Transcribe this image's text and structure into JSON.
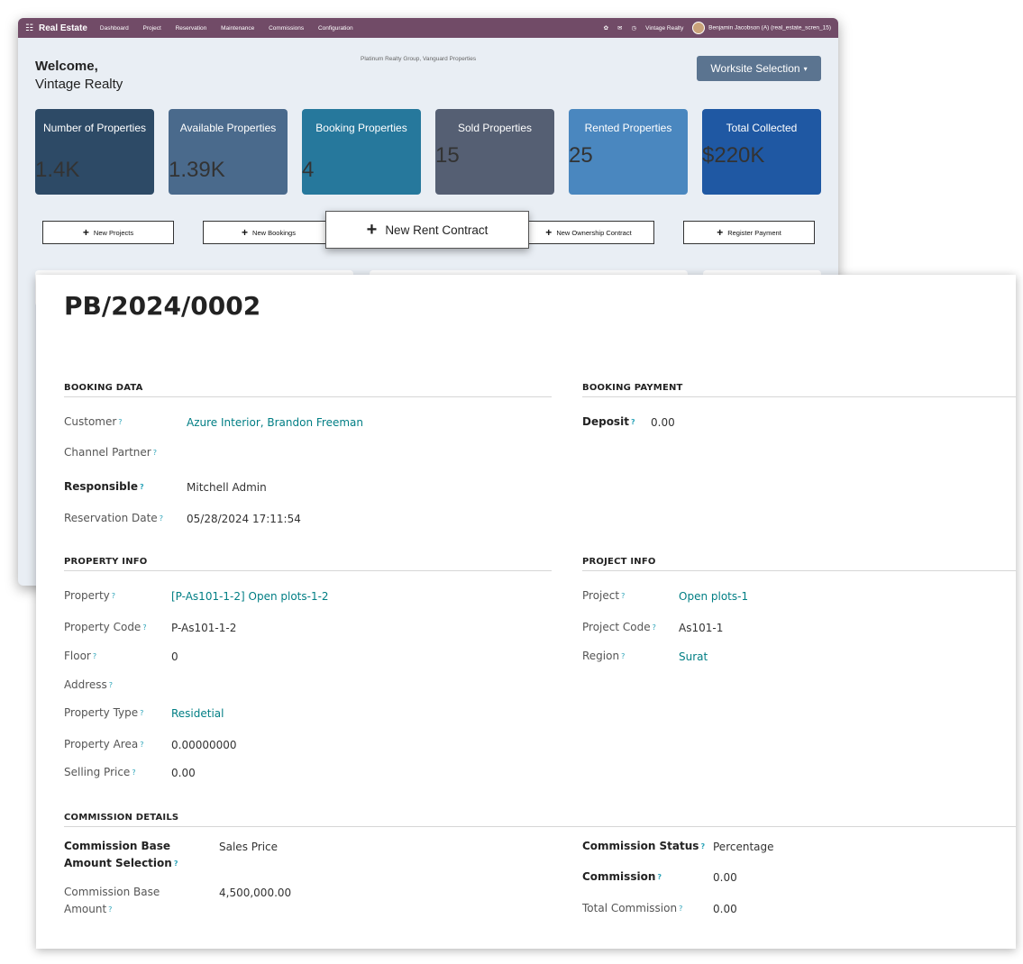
{
  "dashboard": {
    "app_title": "Real Estate",
    "menu": [
      "Dashboard",
      "Project",
      "Reservation",
      "Maintenance",
      "Commissions",
      "Configuration"
    ],
    "company": "Vintage Realty",
    "user": "Benjamin Jacobson (A) (real_estate_scren_15)",
    "welcome_line1": "Welcome,",
    "welcome_line2": "Vintage Realty",
    "companies_caption": "Platinum Realty Group, Vanguard Properties",
    "worksite_button": "Worksite Selection",
    "cards": [
      {
        "label": "Number of Properties",
        "value": "1.4K",
        "color": "#2d4a66"
      },
      {
        "label": "Available Properties",
        "value": "1.39K",
        "color": "#4a6a8c"
      },
      {
        "label": "Booking Properties",
        "value": "4",
        "color": "#26789c"
      },
      {
        "label": "Sold Properties",
        "value": "15",
        "color": "#555f73"
      },
      {
        "label": "Rented Properties",
        "value": "25",
        "color": "#4a87bf"
      },
      {
        "label": "Total Collected",
        "value": "$220K",
        "color": "#1f58a3"
      }
    ],
    "actions": [
      "New Projects",
      "New Bookings",
      "New Ownership Contract",
      "Register Payment"
    ],
    "highlight_action": "New Rent Contract"
  },
  "form": {
    "title": "PB/2024/0002",
    "booking_data": {
      "heading": "BOOKING DATA",
      "customer_label": "Customer",
      "customer": "Azure Interior, Brandon Freeman",
      "channel_partner_label": "Channel Partner",
      "responsible_label": "Responsible",
      "responsible": "Mitchell Admin",
      "reservation_date_label": "Reservation Date",
      "reservation_date": "05/28/2024 17:11:54"
    },
    "booking_payment": {
      "heading": "BOOKING PAYMENT",
      "deposit_label": "Deposit",
      "deposit": "0.00"
    },
    "property_info": {
      "heading": "PROPERTY INFO",
      "property_label": "Property",
      "property": "[P-As101-1-2] Open plots-1-2",
      "code_label": "Property Code",
      "code": "P-As101-1-2",
      "floor_label": "Floor",
      "floor": "0",
      "address_label": "Address",
      "type_label": "Property Type",
      "type": "Residetial",
      "area_label": "Property Area",
      "area": "0.00000000",
      "price_label": "Selling Price",
      "price": "0.00"
    },
    "project_info": {
      "heading": "PROJECT INFO",
      "project_label": "Project",
      "project": "Open plots-1",
      "code_label": "Project Code",
      "code": "As101-1",
      "region_label": "Region",
      "region": "Surat"
    },
    "commission": {
      "heading": "COMMISSION DETAILS",
      "base_sel_label_1": "Commission Base",
      "base_sel_label_2": "Amount Selection",
      "base_sel": "Sales Price",
      "base_amt_label_1": "Commission Base",
      "base_amt_label_2": "Amount",
      "base_amt": "4,500,000.00",
      "status_label": "Commission Status",
      "status": "Percentage",
      "commission_label": "Commission",
      "commission": "0.00",
      "total_label": "Total Commission",
      "total": "0.00"
    }
  }
}
